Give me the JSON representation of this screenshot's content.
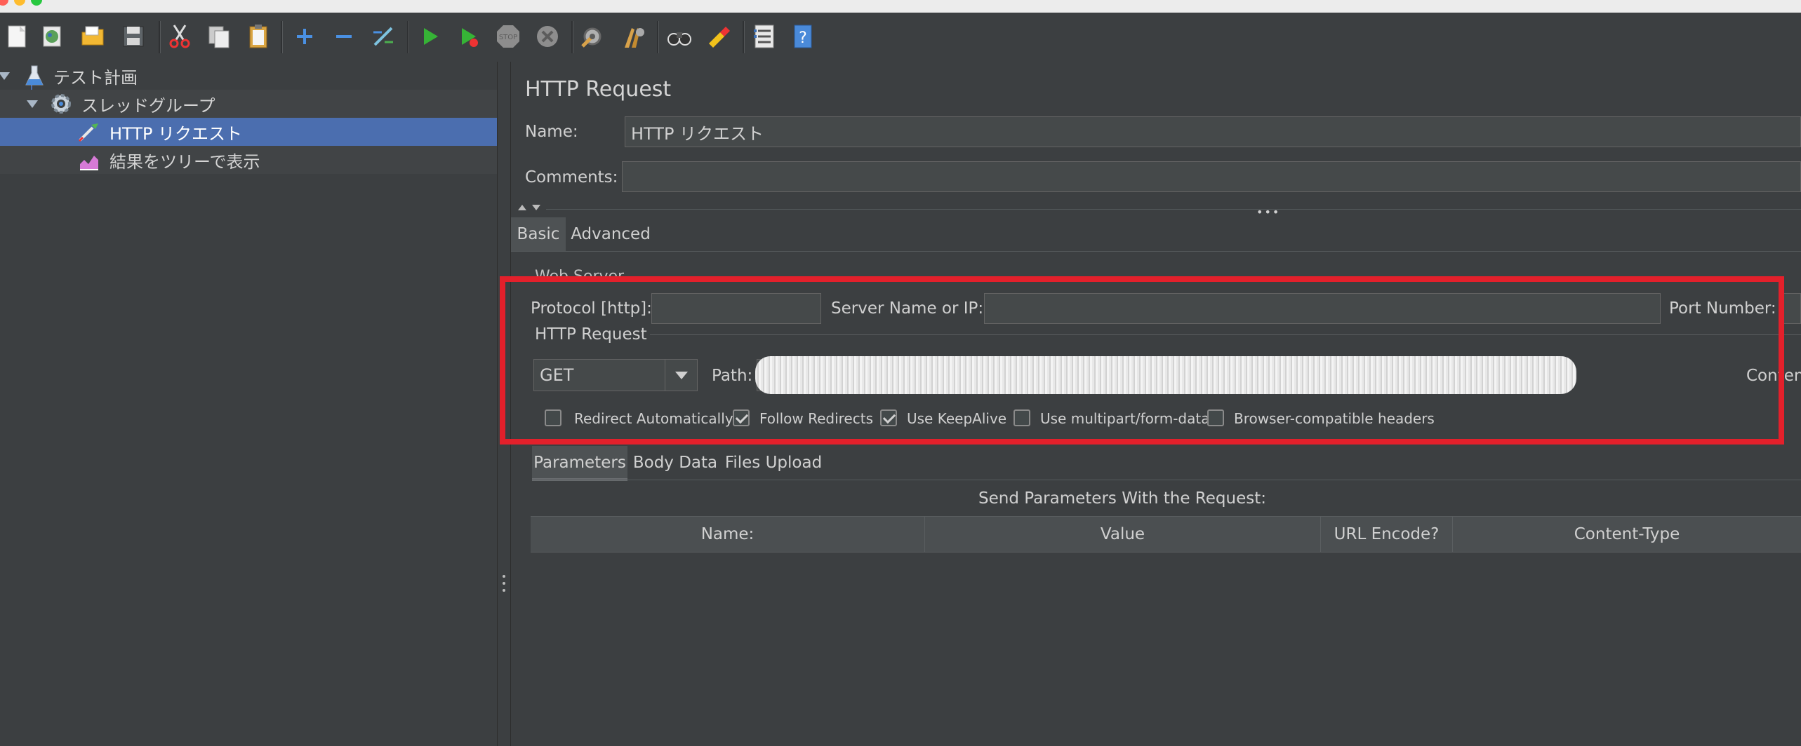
{
  "toolbar": {
    "buttons": [
      "new-icon",
      "templates-icon",
      "open-icon",
      "save-icon",
      "cut-icon",
      "copy-icon",
      "paste-icon",
      "expand-icon",
      "collapse-icon",
      "toggle-icon",
      "start-icon",
      "start-no-pauses-icon",
      "stop-icon",
      "shutdown-icon",
      "clear-icon",
      "clear-all-icon",
      "search-icon",
      "reset-search-icon",
      "function-helper-icon",
      "help-icon"
    ],
    "stop_text": "STOP"
  },
  "tree": {
    "items": [
      {
        "label": "テスト計画",
        "icon": "flask-icon"
      },
      {
        "label": "スレッドグループ",
        "icon": "gear-icon"
      },
      {
        "label": "HTTP リクエスト",
        "icon": "pipette-icon"
      },
      {
        "label": "結果をツリーで表示",
        "icon": "chart-icon"
      }
    ]
  },
  "form": {
    "title": "HTTP Request",
    "name_label": "Name:",
    "name_value": "HTTP リクエスト",
    "comments_label": "Comments:",
    "comments_value": ""
  },
  "tabs": {
    "main": [
      "Basic",
      "Advanced"
    ],
    "params": [
      "Parameters",
      "Body Data",
      "Files Upload"
    ]
  },
  "web_server": {
    "legend": "Web Server",
    "protocol_label": "Protocol [http]:",
    "protocol_value": "",
    "server_label": "Server Name or IP:",
    "server_value": "",
    "port_label": "Port Number:"
  },
  "http_request": {
    "legend": "HTTP Request",
    "method": "GET",
    "path_label": "Path:",
    "content_label": "Conten"
  },
  "options": [
    {
      "label": "Redirect Automatically",
      "checked": false
    },
    {
      "label": "Follow Redirects",
      "checked": true
    },
    {
      "label": "Use KeepAlive",
      "checked": true
    },
    {
      "label": "Use multipart/form-data",
      "checked": false
    },
    {
      "label": "Browser-compatible headers",
      "checked": false
    }
  ],
  "params_table": {
    "caption": "Send Parameters With the Request:",
    "columns": [
      "Name:",
      "Value",
      "URL Encode?",
      "Content-Type"
    ]
  },
  "colors": {
    "highlight_red": "#e3202b",
    "selection_blue": "#4b6eaf",
    "background": "#3c3f41"
  }
}
